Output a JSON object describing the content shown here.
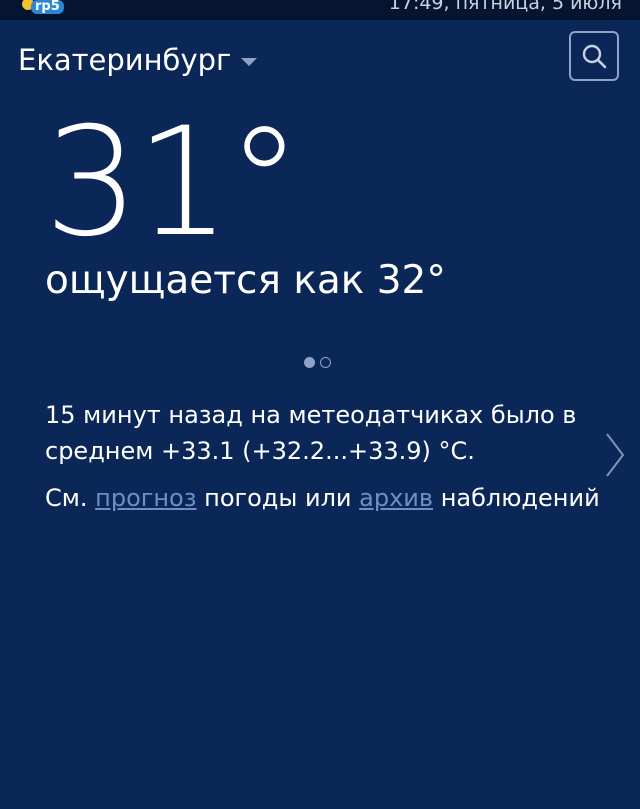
{
  "status_bar": {
    "app_logo_text": "rp5",
    "time_date": "17:49, пятница, 5 июля"
  },
  "header": {
    "city": "Екатеринбург",
    "search_icon": "search-icon",
    "dropdown_icon": "chevron-down-icon"
  },
  "weather": {
    "temperature": "31°",
    "feels_like": "ощущается как 32°"
  },
  "pager": {
    "pages": 2,
    "active_index": 0
  },
  "sensor_text": "15 минут назад на метеодатчиках было в среднем +33.1 (+32.2...+33.9) °C.",
  "links_line": {
    "prefix": "См.",
    "forecast_link": "прогноз",
    "middle": "погоды или",
    "archive_link": "архив",
    "suffix": "наблюдений"
  },
  "next_icon": "chevron-right-icon",
  "colors": {
    "background": "#0b2757",
    "status_bar": "#06152f",
    "link": "#6f8fc4",
    "muted": "#8fa3c4"
  }
}
